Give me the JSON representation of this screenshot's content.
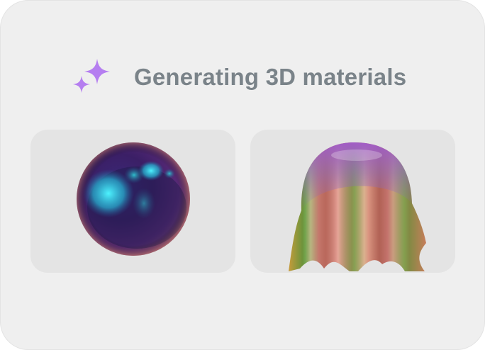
{
  "header": {
    "title": "Generating 3D materials",
    "icon": "sparkle-icon",
    "accent_color": "#b57ef0"
  },
  "previews": [
    {
      "name": "sphere-material-preview",
      "material": "iridescent-sphere"
    },
    {
      "name": "cloth-material-preview",
      "material": "iridescent-cloth"
    }
  ],
  "colors": {
    "card_background": "#efefef",
    "preview_background": "#e4e4e4",
    "title_color": "#7a8389"
  }
}
